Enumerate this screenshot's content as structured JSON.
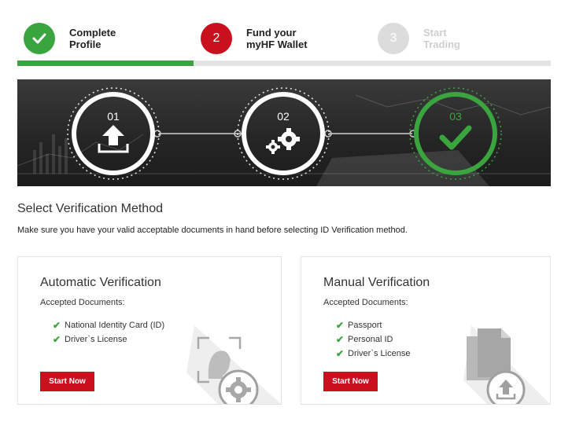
{
  "stepper": {
    "steps": [
      {
        "number": "",
        "label_line1": "Complete",
        "label_line2": "Profile",
        "status": "completed",
        "icon": "check-icon"
      },
      {
        "number": "2",
        "label_line1": "Fund your",
        "label_line2": "myHF Wallet",
        "status": "active"
      },
      {
        "number": "3",
        "label_line1": "Start",
        "label_line2": "Trading",
        "status": "pending"
      }
    ],
    "progress_fraction": 0.33
  },
  "banner": {
    "steps": [
      "01",
      "02",
      "03"
    ],
    "icons": [
      "upload-icon",
      "gears-icon",
      "check-icon"
    ]
  },
  "section": {
    "title": "Select Verification Method",
    "description": "Make sure you have your valid acceptable documents in hand before selecting ID Verification method."
  },
  "cards": {
    "automatic": {
      "title": "Automatic Verification",
      "subtitle": "Accepted Documents:",
      "documents": [
        "National Identity Card (ID)",
        "Driver`s License"
      ],
      "button": "Start Now",
      "icon": "face-scan-gear-icon"
    },
    "manual": {
      "title": "Manual Verification",
      "subtitle": "Accepted Documents:",
      "documents": [
        "Passport",
        "Personal ID",
        "Driver`s License"
      ],
      "button": "Start Now",
      "icon": "documents-upload-icon"
    }
  },
  "colors": {
    "brand_red": "#c8101e",
    "success_green": "#3aa53f",
    "inactive_gray": "#dcdcdc"
  }
}
